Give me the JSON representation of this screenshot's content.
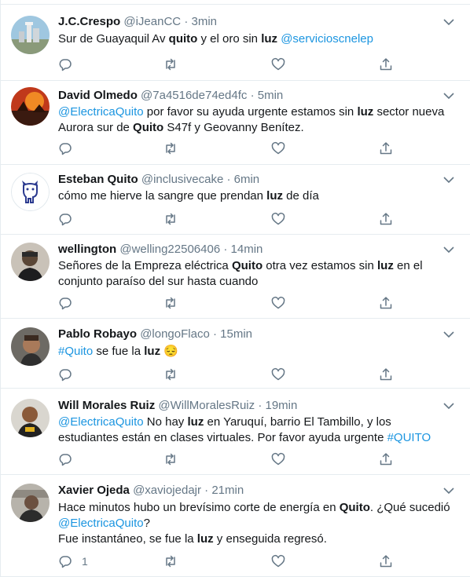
{
  "colors": {
    "text": "#14171a",
    "muted": "#657786",
    "link": "#1b95e0",
    "border": "#e6ecf0"
  },
  "tweets": [
    {
      "name": "J.C.Crespo",
      "handle": "@iJeanCC",
      "time": "3min",
      "segments": [
        {
          "t": "Sur de Guayaquil Av "
        },
        {
          "t": "quito",
          "s": "bold"
        },
        {
          "t": " y el oro sin "
        },
        {
          "t": "luz",
          "s": "bold"
        },
        {
          "t": " "
        },
        {
          "t": "@servicioscnelep",
          "s": "link"
        }
      ],
      "reply_count": ""
    },
    {
      "name": "David Olmedo",
      "handle": "@7a4516de74ed4fc",
      "time": "5min",
      "segments": [
        {
          "t": "@ElectricaQuito",
          "s": "link"
        },
        {
          "t": " por favor su ayuda urgente  estamos sin "
        },
        {
          "t": "luz",
          "s": "bold"
        },
        {
          "t": " sector nueva Aurora sur de "
        },
        {
          "t": "Quito",
          "s": "bold"
        },
        {
          "t": "  S47f y Geovanny Benítez."
        }
      ],
      "reply_count": ""
    },
    {
      "name": "Esteban Quito",
      "handle": "@inclusivecake",
      "time": "6min",
      "segments": [
        {
          "t": "cómo me hierve la sangre que prendan "
        },
        {
          "t": "luz",
          "s": "bold"
        },
        {
          "t": " de día"
        }
      ],
      "reply_count": ""
    },
    {
      "name": "wellington",
      "handle": "@welling22506406",
      "time": "14min",
      "segments": [
        {
          "t": "Señores de la Empreza eléctrica "
        },
        {
          "t": "Quito",
          "s": "bold"
        },
        {
          "t": " otra vez estamos sin "
        },
        {
          "t": "luz",
          "s": "bold"
        },
        {
          "t": " en el conjunto paraíso del sur hasta cuando"
        }
      ],
      "reply_count": ""
    },
    {
      "name": "Pablo Robayo",
      "handle": "@longoFlaco",
      "time": "15min",
      "segments": [
        {
          "t": "#Quito",
          "s": "link"
        },
        {
          "t": " se fue la "
        },
        {
          "t": "luz",
          "s": "bold"
        },
        {
          "t": " 😔"
        }
      ],
      "reply_count": ""
    },
    {
      "name": "Will Morales Ruiz",
      "handle": "@WillMoralesRuiz",
      "time": "19min",
      "segments": [
        {
          "t": "@ElectricaQuito",
          "s": "link"
        },
        {
          "t": " No hay "
        },
        {
          "t": "luz",
          "s": "bold"
        },
        {
          "t": " en Yaruquí, barrio El Tambillo, y los estudiantes están en clases virtuales. Por favor ayuda urgente "
        },
        {
          "t": "#QUITO",
          "s": "link"
        }
      ],
      "reply_count": ""
    },
    {
      "name": "Xavier Ojeda",
      "handle": "@xaviojedajr",
      "time": "21min",
      "segments": [
        {
          "t": "Hace minutos hubo un brevísimo corte de energía en "
        },
        {
          "t": "Quito",
          "s": "bold"
        },
        {
          "t": ". ¿Qué sucedió "
        },
        {
          "t": "@ElectricaQuito",
          "s": "link"
        },
        {
          "t": "?"
        },
        {
          "br": true
        },
        {
          "t": "Fue instantáneo, se fue la "
        },
        {
          "t": "luz",
          "s": "bold"
        },
        {
          "t": " y enseguida regresó."
        }
      ],
      "reply_count": "1"
    }
  ]
}
